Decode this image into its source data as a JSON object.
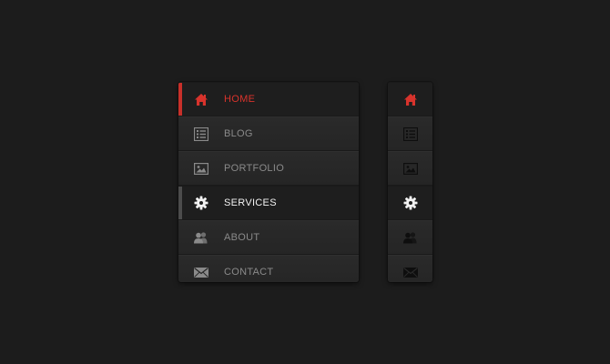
{
  "colors": {
    "background": "#1c1c1c",
    "menu_bg": "#262626",
    "active_red": "#c8302a",
    "active_white": "#f2f2f2",
    "inactive_text": "#8a8a8a",
    "inactive_icon_wide": "#8a8a8a",
    "inactive_icon_narrow": "#0e0e0e"
  },
  "wide_menu": {
    "items": [
      {
        "label": "HOME",
        "icon": "home-icon",
        "state": "active-home"
      },
      {
        "label": "BLOG",
        "icon": "blog-list-icon",
        "state": "normal"
      },
      {
        "label": "PORTFOLIO",
        "icon": "image-icon",
        "state": "normal"
      },
      {
        "label": "SERVICES",
        "icon": "gear-icon",
        "state": "active-services"
      },
      {
        "label": "ABOUT",
        "icon": "users-icon",
        "state": "normal"
      },
      {
        "label": "CONTACT",
        "icon": "envelope-icon",
        "state": "normal"
      }
    ]
  },
  "narrow_menu": {
    "items": [
      {
        "icon": "home-icon",
        "state": "active-home"
      },
      {
        "icon": "blog-list-icon",
        "state": "normal"
      },
      {
        "icon": "image-icon",
        "state": "normal"
      },
      {
        "icon": "gear-icon",
        "state": "active-services"
      },
      {
        "icon": "users-icon",
        "state": "normal"
      },
      {
        "icon": "envelope-icon",
        "state": "normal"
      }
    ]
  }
}
